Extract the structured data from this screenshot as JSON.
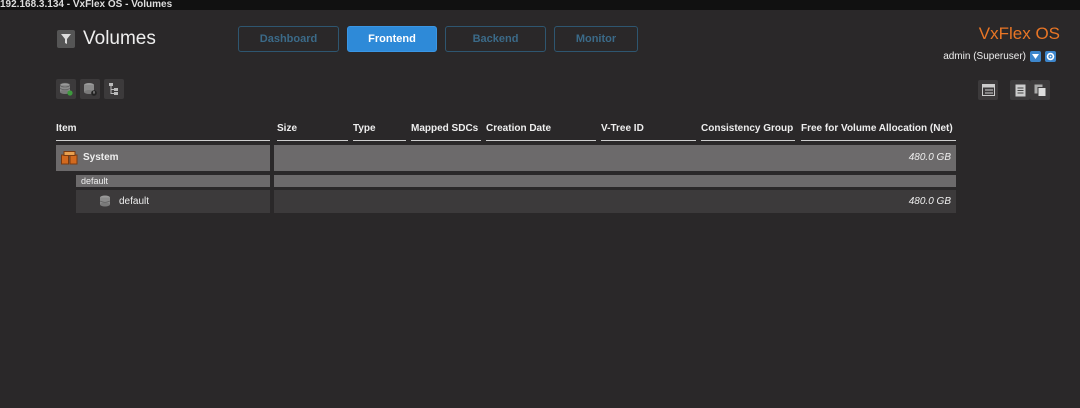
{
  "window": {
    "title": "192.168.3.134 - VxFlex OS - Volumes"
  },
  "header": {
    "title": "Volumes"
  },
  "nav": {
    "dashboard": "Dashboard",
    "frontend": "Frontend",
    "backend": "Backend",
    "monitor": "Monitor"
  },
  "brand": {
    "part1": "VxFlex",
    "part2": "OS"
  },
  "user": {
    "label": "admin (Superuser)"
  },
  "table": {
    "columns": {
      "item": "Item",
      "size": "Size",
      "type": "Type",
      "mapped_sdcs": "Mapped SDCs",
      "creation_date": "Creation Date",
      "vtree_id": "V-Tree ID",
      "consistency_group": "Consistency Group",
      "free_alloc": "Free for Volume Allocation (Net)"
    },
    "system_row": {
      "item": "System",
      "free": "480.0 GB"
    },
    "group_row": {
      "item": "default"
    },
    "pool_row": {
      "item": "default",
      "free": "480.0 GB"
    }
  },
  "colors": {
    "accent": "#2e8ad8",
    "brand": "#e87525",
    "background": "#2a2829"
  }
}
